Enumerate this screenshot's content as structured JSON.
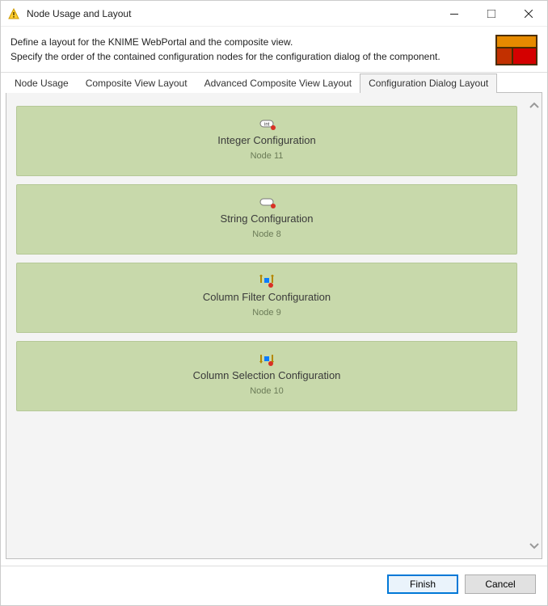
{
  "window": {
    "title": "Node Usage and Layout"
  },
  "header": {
    "line1": "Define a layout for the KNIME WebPortal and the composite view.",
    "line2": "Specify the order of the contained configuration nodes for the configuration dialog of the component."
  },
  "tabs": {
    "t0": "Node Usage",
    "t1": "Composite View Layout",
    "t2": "Advanced Composite View Layout",
    "t3": "Configuration Dialog Layout"
  },
  "nodes": [
    {
      "icon": "integer",
      "title": "Integer Configuration",
      "sub": "Node 11"
    },
    {
      "icon": "string",
      "title": "String Configuration",
      "sub": "Node 8"
    },
    {
      "icon": "colfilter",
      "title": "Column Filter Configuration",
      "sub": "Node 9"
    },
    {
      "icon": "colselect",
      "title": "Column Selection Configuration",
      "sub": "Node 10"
    }
  ],
  "buttons": {
    "finish": "Finish",
    "cancel": "Cancel"
  }
}
